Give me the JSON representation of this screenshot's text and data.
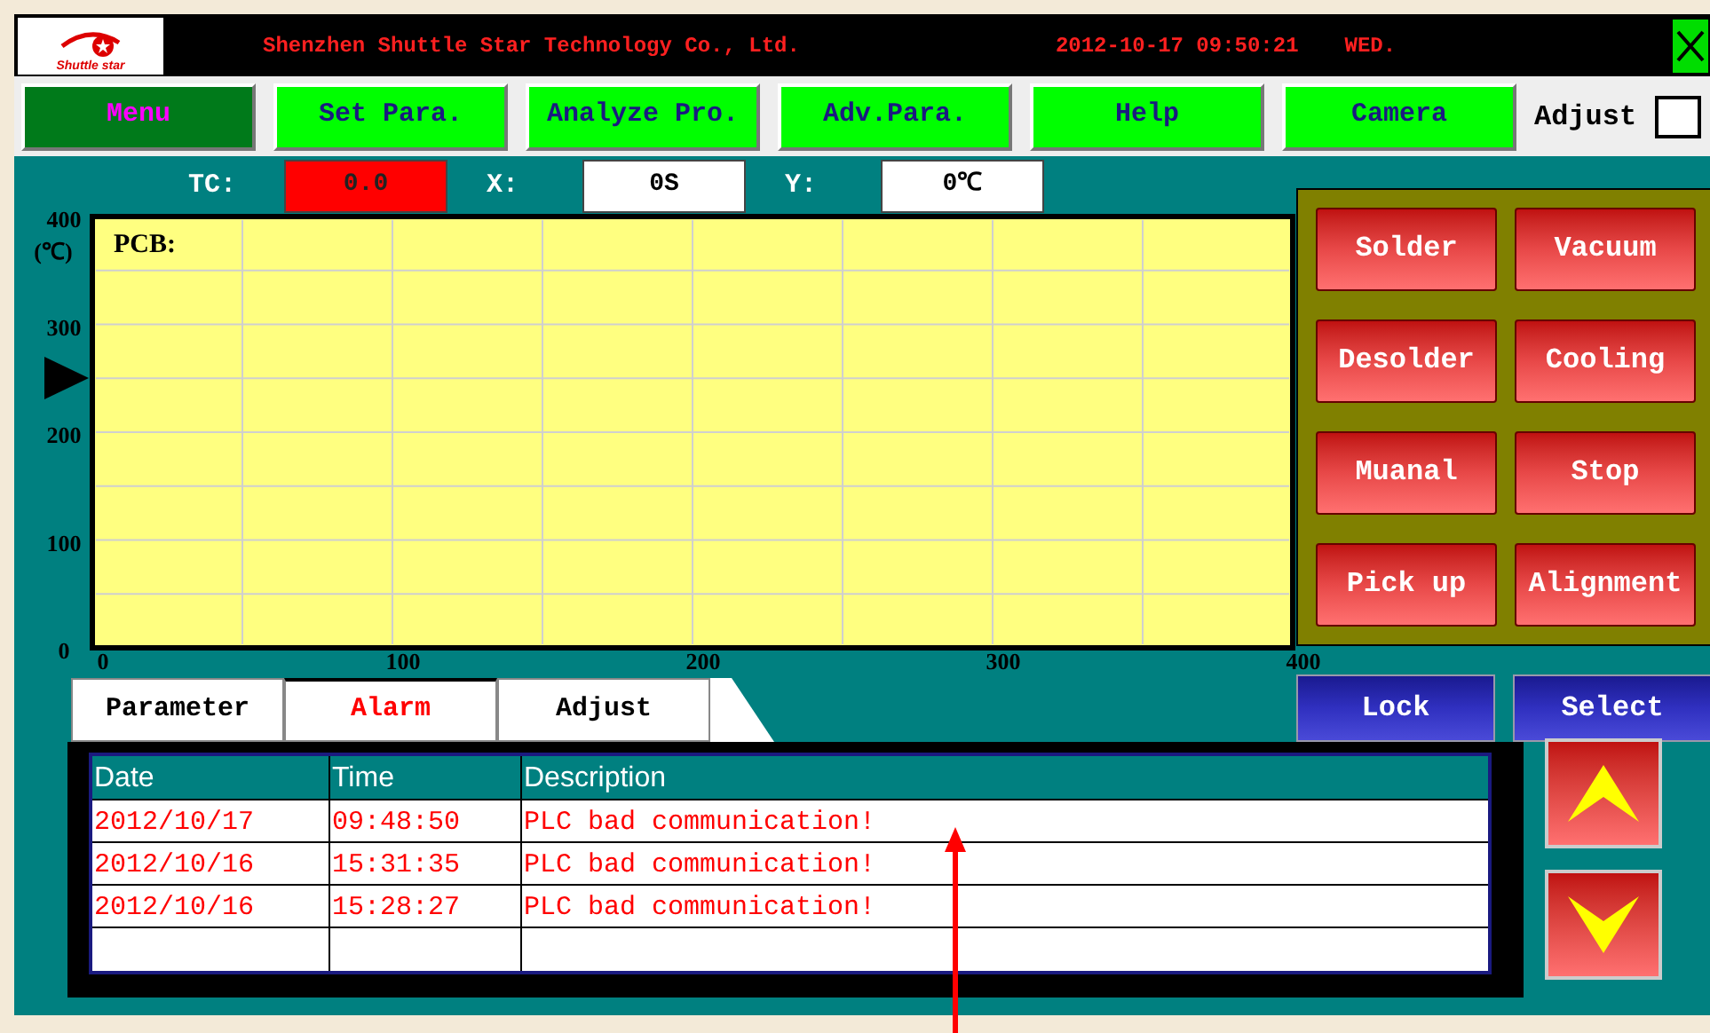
{
  "header": {
    "logo_text": "Shuttle star",
    "company": "Shenzhen Shuttle Star Technology Co., Ltd.",
    "datetime": "2012-10-17 09:50:21",
    "weekday": "WED."
  },
  "nav": [
    {
      "label": "Menu",
      "selected": true
    },
    {
      "label": "Set Para.",
      "selected": false
    },
    {
      "label": "Analyze Pro.",
      "selected": false
    },
    {
      "label": "Adv.Para.",
      "selected": false
    },
    {
      "label": "Help",
      "selected": false
    },
    {
      "label": "Camera",
      "selected": false
    }
  ],
  "adjust_label": "Adjust",
  "adjust_checked": false,
  "readouts": [
    {
      "label": "TC:",
      "value": "0.0",
      "kind": "alert"
    },
    {
      "label": "X:",
      "value": "0S",
      "kind": "plain"
    },
    {
      "label": "Y:",
      "value": "0℃",
      "kind": "plain"
    }
  ],
  "chart": {
    "chart_data": {
      "type": "line",
      "grid": true,
      "title": "PCB:",
      "ylabel": "(℃)",
      "xlim": [
        0,
        400
      ],
      "ylim": [
        0,
        400
      ],
      "xticks": [
        0,
        100,
        200,
        300,
        400
      ],
      "yticks": [
        0,
        100,
        200,
        300,
        400
      ]
    }
  },
  "action_buttons": [
    "Solder",
    "Vacuum",
    "Desolder",
    "Cooling",
    "Muanal",
    "Stop",
    "Pick up",
    "Alignment"
  ],
  "side_buttons": [
    "Lock",
    "Select"
  ],
  "tabs": [
    {
      "label": "Parameter",
      "selected": false
    },
    {
      "label": "Alarm",
      "selected": true
    },
    {
      "label": "Adjust",
      "selected": false
    }
  ],
  "alarm_table": {
    "columns": [
      "Date",
      "Time",
      "Description"
    ],
    "rows": [
      [
        "2012/10/17",
        "09:48:50",
        "PLC bad communication!"
      ],
      [
        "2012/10/16",
        "15:31:35",
        "PLC bad communication!"
      ],
      [
        "2012/10/16",
        "15:28:27",
        "PLC bad communication!"
      ]
    ]
  }
}
